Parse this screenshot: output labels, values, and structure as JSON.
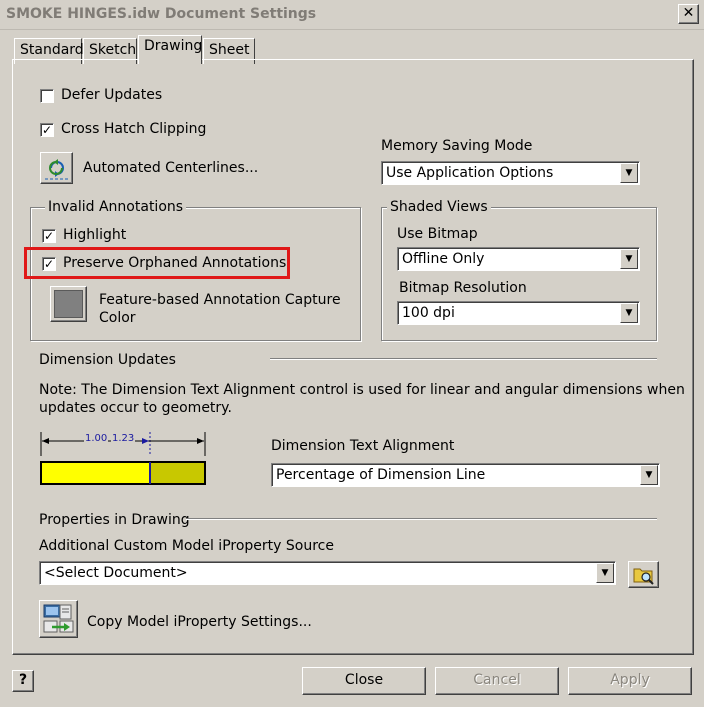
{
  "window": {
    "title": "SMOKE HINGES.idw Document Settings",
    "close_glyph": "✕"
  },
  "tabs": [
    {
      "label": "Standard",
      "active": false
    },
    {
      "label": "Sketch",
      "active": false
    },
    {
      "label": "Drawing",
      "active": true
    },
    {
      "label": "Sheet",
      "active": false
    }
  ],
  "options": {
    "defer_updates": {
      "label": "Defer Updates",
      "checked": false
    },
    "cross_hatch_clipping": {
      "label": "Cross Hatch Clipping",
      "checked": true
    },
    "automated_centerlines_label": "Automated Centerlines..."
  },
  "memory_saving": {
    "label": "Memory Saving Mode",
    "value": "Use Application Options"
  },
  "invalid_annotations": {
    "title": "Invalid Annotations",
    "highlight": {
      "label": "Highlight",
      "checked": true
    },
    "preserve_orphaned": {
      "label": "Preserve Orphaned Annotations",
      "checked": true
    },
    "capture_color_line1": "Feature-based Annotation Capture",
    "capture_color_line2": "Color",
    "capture_color_swatch": "#808080"
  },
  "shaded_views": {
    "title": "Shaded Views",
    "use_bitmap_label": "Use Bitmap",
    "use_bitmap_value": "Offline Only",
    "bitmap_resolution_label": "Bitmap Resolution",
    "bitmap_resolution_value": "100 dpi"
  },
  "dimension_updates": {
    "title": "Dimension Updates",
    "note_line1": "Note: The Dimension Text Alignment control is used for linear and angular dimensions when",
    "note_line2": "updates occur to geometry.",
    "preview_text1": "1.00",
    "preview_text2": "1.23",
    "alignment_label": "Dimension Text Alignment",
    "alignment_value": "Percentage of Dimension Line",
    "preview_colors": {
      "primary": "#ffff00",
      "secondary": "#c8c800",
      "dim_line": "#1a1aa0"
    }
  },
  "properties": {
    "title": "Properties in Drawing",
    "source_label": "Additional Custom Model iProperty Source",
    "source_value": "<Select Document>",
    "copy_settings_label": "Copy Model iProperty Settings..."
  },
  "footer": {
    "help_glyph": "?",
    "close_label": "Close",
    "cancel_label": "Cancel",
    "apply_label": "Apply"
  },
  "accent": {
    "highlight_box": "#e01818"
  }
}
